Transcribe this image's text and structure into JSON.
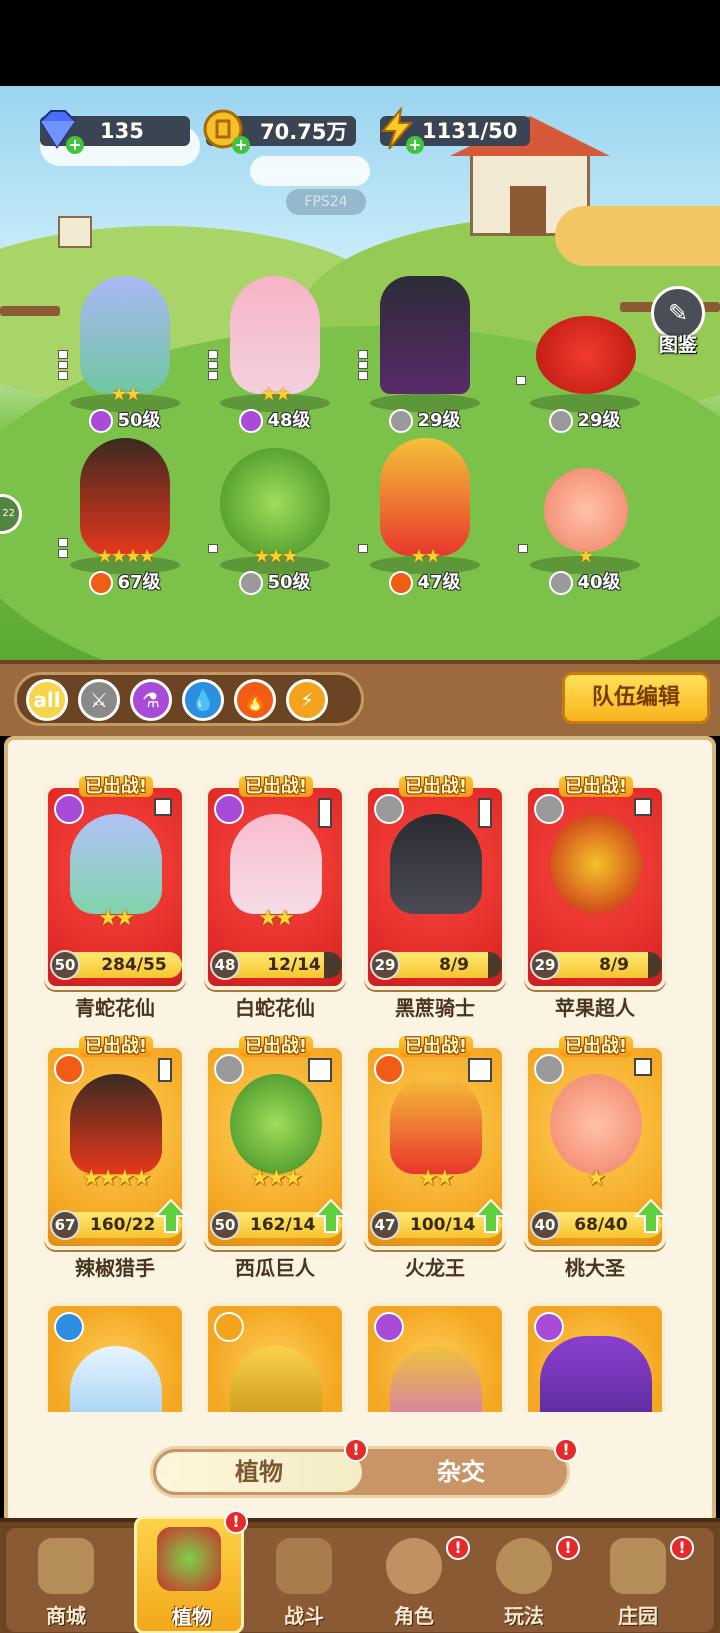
{
  "resources": {
    "gems": "135",
    "gold": "70.75万",
    "energy": "1131/50",
    "fps": "FPS24"
  },
  "scene": {
    "codex_label": "图鉴",
    "side_badge": "22"
  },
  "heroes": [
    {
      "level": "50级",
      "stars": "★★",
      "elem_color": "#a84bd9"
    },
    {
      "level": "48级",
      "stars": "★★",
      "elem_color": "#a84bd9"
    },
    {
      "level": "29级",
      "stars": "",
      "elem_color": "#9a9a9a"
    },
    {
      "level": "29级",
      "stars": "",
      "elem_color": "#9a9a9a"
    },
    {
      "level": "67级",
      "stars": "★★★★",
      "elem_color": "#f25d16"
    },
    {
      "level": "50级",
      "stars": "★★★",
      "elem_color": "#9a9a9a"
    },
    {
      "level": "47级",
      "stars": "★★",
      "elem_color": "#f25d16"
    },
    {
      "level": "40级",
      "stars": "★",
      "elem_color": "#9a9a9a"
    }
  ],
  "filters": {
    "all_label": "all",
    "team_edit_label": "队伍编辑"
  },
  "cards": [
    {
      "name": "青蛇花仙",
      "level": "50",
      "progress": "284/55",
      "fill": 1.0,
      "stars": "★★",
      "deployed": "已出战!",
      "upgrade": false
    },
    {
      "name": "白蛇花仙",
      "level": "48",
      "progress": "12/14",
      "fill": 0.86,
      "stars": "★★",
      "deployed": "已出战!",
      "upgrade": false
    },
    {
      "name": "黑蔗骑士",
      "level": "29",
      "progress": "8/9",
      "fill": 0.89,
      "stars": "",
      "deployed": "已出战!",
      "upgrade": false
    },
    {
      "name": "苹果超人",
      "level": "29",
      "progress": "8/9",
      "fill": 0.89,
      "stars": "",
      "deployed": "已出战!",
      "upgrade": false
    },
    {
      "name": "辣椒猎手",
      "level": "67",
      "progress": "160/22",
      "fill": 1.0,
      "stars": "★★★★",
      "deployed": "已出战!",
      "upgrade": true
    },
    {
      "name": "西瓜巨人",
      "level": "50",
      "progress": "162/14",
      "fill": 1.0,
      "stars": "★★★",
      "deployed": "已出战!",
      "upgrade": true
    },
    {
      "name": "火龙王",
      "level": "47",
      "progress": "100/14",
      "fill": 1.0,
      "stars": "★★",
      "deployed": "已出战!",
      "upgrade": true
    },
    {
      "name": "桃大圣",
      "level": "40",
      "progress": "68/40",
      "fill": 1.0,
      "stars": "★",
      "deployed": "已出战!",
      "upgrade": true
    }
  ],
  "toggle": {
    "left": "植物",
    "right": "杂交",
    "alert": "!"
  },
  "nav": [
    {
      "label": "商城",
      "alert": ""
    },
    {
      "label": "植物",
      "alert": "!"
    },
    {
      "label": "战斗",
      "alert": ""
    },
    {
      "label": "角色",
      "alert": "!"
    },
    {
      "label": "玩法",
      "alert": "!"
    },
    {
      "label": "庄园",
      "alert": "!"
    }
  ]
}
